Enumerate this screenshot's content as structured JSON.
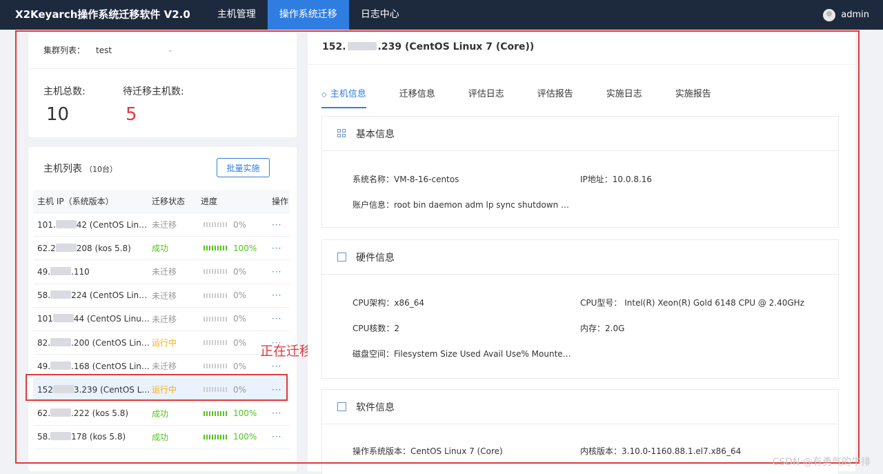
{
  "navbar": {
    "brand": "X2Keyarch操作系统迁移软件 V2.0",
    "items": [
      "主机管理",
      "操作系统迁移",
      "日志中心"
    ],
    "active_index": 1,
    "user": "admin"
  },
  "cluster": {
    "label": "集群列表：",
    "selected": "test",
    "total_label": "主机总数:",
    "total_value": "10",
    "pending_label": "待迁移主机数:",
    "pending_value": "5"
  },
  "host_list": {
    "title": "主机列表",
    "count": "（10台）",
    "batch_button": "批量实施",
    "columns": [
      "主机 IP（系统版本）",
      "迁移状态",
      "进度",
      "操作"
    ],
    "rows": [
      {
        "ip_a": "101.",
        "ip_b": "42 (CentOS Linux ...",
        "status": "未迁移",
        "progress": "0%"
      },
      {
        "ip_a": "62.2",
        "ip_b": "208 (kos 5.8)",
        "status": "成功",
        "progress": "100%"
      },
      {
        "ip_a": "49.",
        "ip_b": ".110",
        "status": "未迁移",
        "progress": "0%"
      },
      {
        "ip_a": "58.",
        "ip_b": "224 (CentOS Linux 7 ...",
        "status": "未迁移",
        "progress": "0%"
      },
      {
        "ip_a": "101",
        "ip_b": "44 (CentOS Linux...",
        "status": "未迁移",
        "progress": "0%"
      },
      {
        "ip_a": "82.",
        "ip_b": ".200 (CentOS Linux...",
        "status": "运行中",
        "progress": "0%"
      },
      {
        "ip_a": "49.",
        "ip_b": ".168 (CentOS Linux...",
        "status": "未迁移",
        "progress": "0%"
      },
      {
        "ip_a": "152",
        "ip_b": "3.239 (CentOS Lin...",
        "status": "运行中",
        "progress": "0%"
      },
      {
        "ip_a": "62.",
        "ip_b": ".222 (kos 5.8)",
        "status": "成功",
        "progress": "100%"
      },
      {
        "ip_a": "58.",
        "ip_b": "178 (kos 5.8)",
        "status": "成功",
        "progress": "100%"
      }
    ],
    "selected_row": 7,
    "op_label": "···"
  },
  "annotation": "正在迁移中",
  "detail": {
    "title_a": "152.",
    "title_b": ".239 (CentOS Linux 7 (Core))",
    "tabs": [
      "主机信息",
      "迁移信息",
      "评估日志",
      "评估报告",
      "实施日志",
      "实施报告"
    ],
    "active_tab": 0,
    "basic": {
      "title": "基本信息",
      "sysname_label": "系统名称：",
      "sysname": "VM-8-16-centos",
      "ip_label": "IP地址：",
      "ip": "10.0.8.16",
      "account_label": "账户信息：",
      "account": "root bin daemon adm lp sync shutdown hal..."
    },
    "hardware": {
      "title": "硬件信息",
      "arch_label": "CPU架构：",
      "arch": "x86_64",
      "model_label": "CPU型号：",
      "model": "Intel(R) Xeon(R) Gold 6148 CPU @ 2.40GHz",
      "cores_label": "CPU核数：",
      "cores": "2",
      "mem_label": "内存：",
      "mem": "2.0G",
      "disk_label": "磁盘空间：",
      "disk": "Filesystem Size Used Avail Use% Mounted o..."
    },
    "software": {
      "title": "软件信息",
      "os_label": "操作系统版本：",
      "os": "CentOS Linux 7 (Core)",
      "kernel_label": "内核版本：",
      "kernel": "3.10.0-1160.88.1.el7.x86_64"
    }
  },
  "watermark": "CSDN @有勇气的牛排",
  "colors": {
    "accent": "#2f7de1",
    "success": "#52c41a",
    "running": "#faad14",
    "danger": "#e0393e",
    "navbar": "#1d2a3d"
  }
}
